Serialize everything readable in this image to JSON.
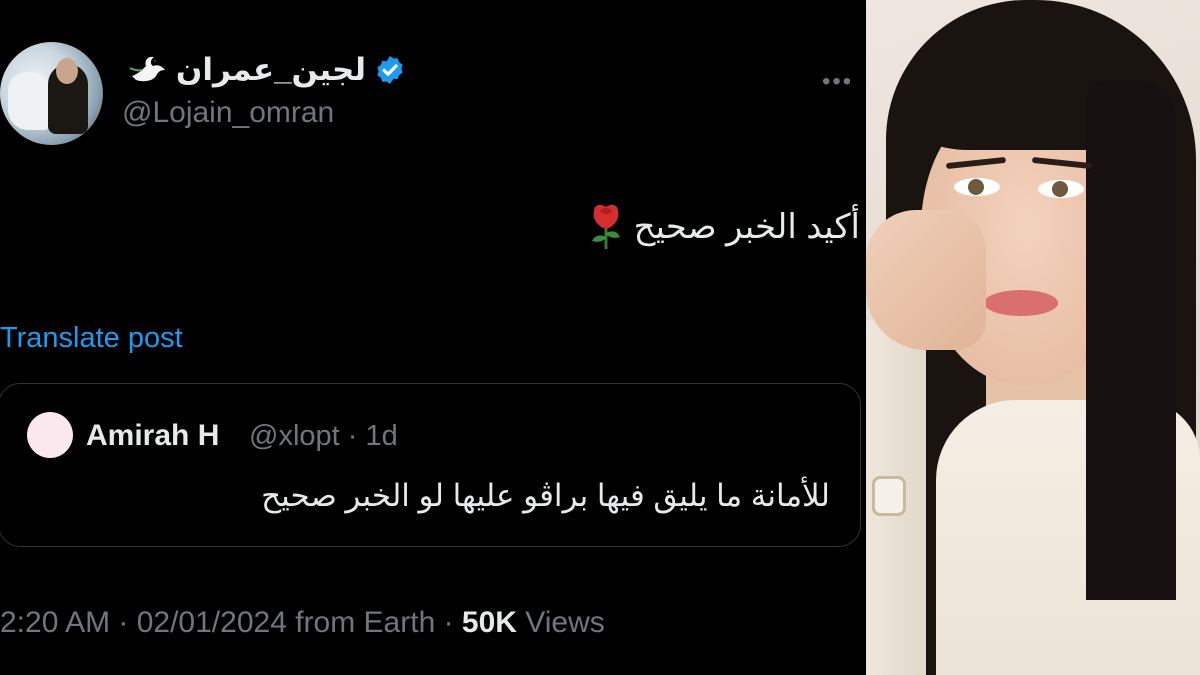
{
  "tweet": {
    "author": {
      "display_name": "لجين_عمران",
      "handle": "@Lojain_omran",
      "verified": true,
      "emoji": "dove",
      "verified_color": "#1d9bf0"
    },
    "more_label": "•••",
    "text": "أكيد الخبر صحيح",
    "text_emoji": "rose",
    "translate_label": "Translate post",
    "quoted": {
      "display_name": "Amirah H",
      "handle_time": "@xlopt · 1d",
      "text": "للأمانة ما يليق فيها براڤو عليها لو الخبر صحيح"
    },
    "meta": {
      "time_date_source": "2:20 AM · 02/01/2024 from Earth · ",
      "views_count": "50K",
      "views_label": " Views"
    }
  },
  "colors": {
    "background": "#000000",
    "text_primary": "#e7e9ea",
    "text_secondary": "#71767b",
    "link": "#1d9bf0",
    "border": "#2f3336"
  }
}
